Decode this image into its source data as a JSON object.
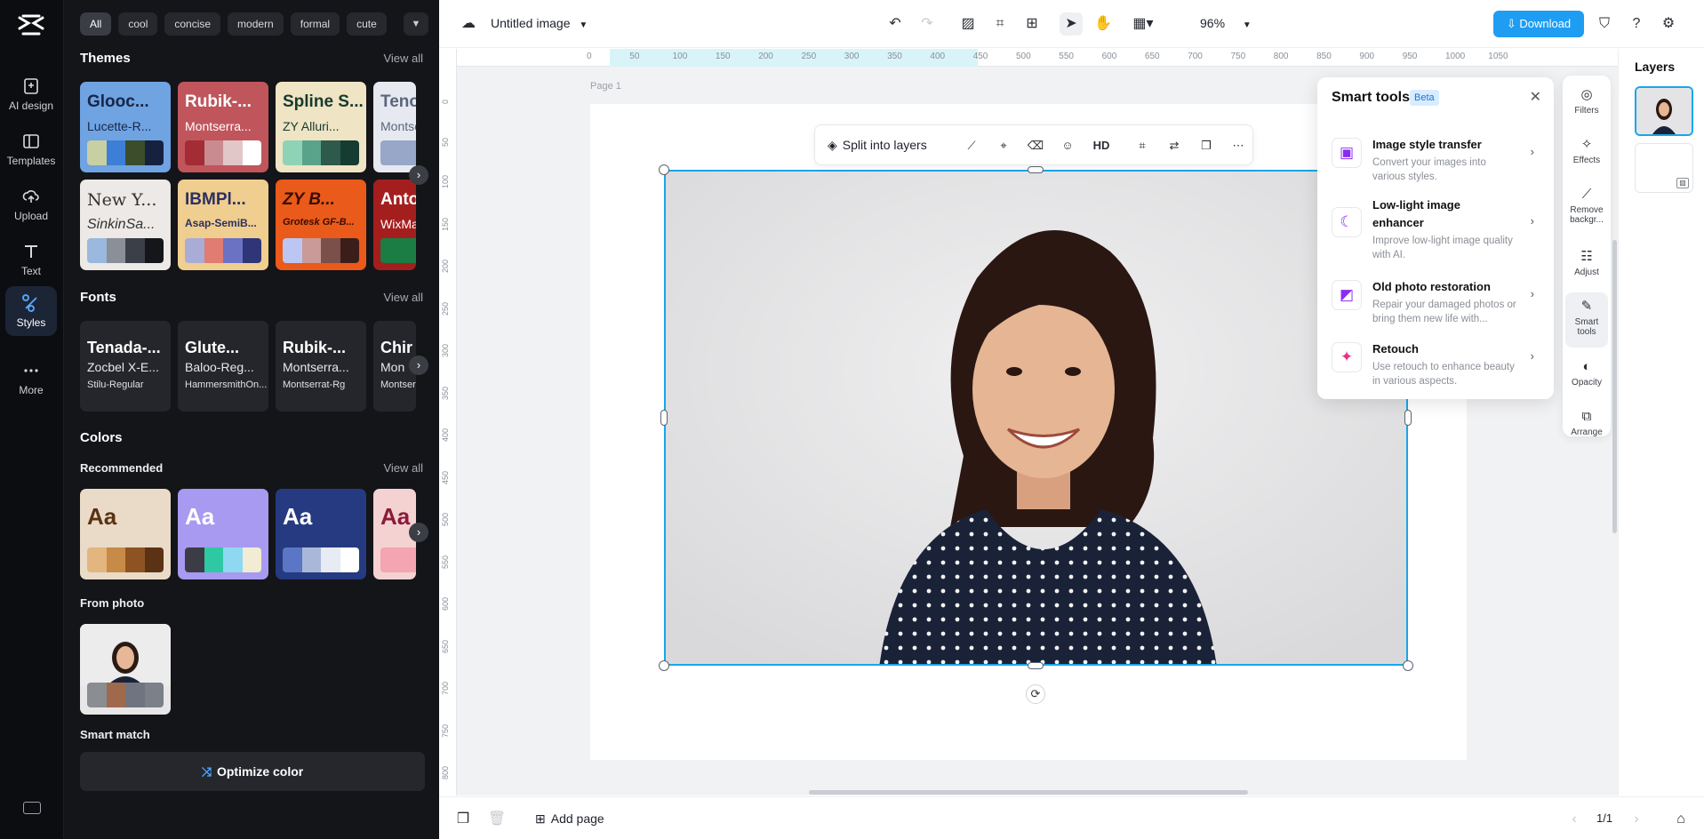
{
  "rail": {
    "items": [
      {
        "label": "AI design",
        "icon": "ai-design-icon"
      },
      {
        "label": "Templates",
        "icon": "templates-icon"
      },
      {
        "label": "Upload",
        "icon": "upload-icon"
      },
      {
        "label": "Text",
        "icon": "text-icon"
      },
      {
        "label": "Styles",
        "icon": "styles-icon",
        "active": true
      },
      {
        "label": "More",
        "icon": "more-dots-icon"
      }
    ]
  },
  "filters": {
    "chips": [
      "All",
      "cool",
      "concise",
      "modern",
      "formal",
      "cute"
    ],
    "selected": "All"
  },
  "themes": {
    "title": "Themes",
    "view_all": "View all",
    "cards": [
      {
        "t1": "Glooc...",
        "t2": "Lucette-R...",
        "bg": "#6fa3e2",
        "fg": "#17264a",
        "swatches": [
          "#c8cfa2",
          "#3d7fd6",
          "#3b4d2b",
          "#16213f"
        ]
      },
      {
        "t1": "Rubik-...",
        "t2": "Montserra...",
        "bg": "#c0555c",
        "fg": "#ffffff",
        "swatches": [
          "#a32c35",
          "#c98b8f",
          "#e1c7c8",
          "#ffffff"
        ]
      },
      {
        "t1": "Spline S...",
        "t2": "ZY Alluri...",
        "bg": "#efe4c4",
        "fg": "#173a2e",
        "swatches": [
          "#8fd3b7",
          "#5aa38b",
          "#2d5a4b",
          "#163b30"
        ]
      },
      {
        "t1": "Tenor",
        "t2": "Montse",
        "bg": "#e6e9f0",
        "fg": "#5b667d",
        "swatches": [
          "#98a6c8",
          "#5f6f99"
        ]
      },
      {
        "t1": "New Y...",
        "t2": "SinkinSa...",
        "bg": "#ece9e6",
        "fg": "#333333",
        "swatches": [
          "#9bb8de",
          "#8a8f98",
          "#3b4048",
          "#14161a"
        ]
      },
      {
        "t1": "IBMPl...",
        "t2": "Asap-SemiB...",
        "bg": "#f0ce8f",
        "fg": "#2b2f62",
        "swatches": [
          "#a8acd6",
          "#e07c72",
          "#6b72c4",
          "#2f3577"
        ]
      },
      {
        "t1": "ZY B...",
        "t2": "Grotesk GF-B...",
        "bg": "#ea5a1a",
        "fg": "#3a0d00",
        "swatches": [
          "#bcc6f3",
          "#c99a97",
          "#7b4f4a",
          "#3b1e1a"
        ]
      },
      {
        "t1": "Antonio",
        "t2": "WixMad",
        "bg": "#a51e1e",
        "fg": "#ffffff",
        "swatches": [
          "#1b7d44",
          "#3fb27a"
        ]
      }
    ]
  },
  "fonts": {
    "title": "Fonts",
    "view_all": "View all",
    "cards": [
      {
        "f1": "Tenada-...",
        "f2": "Zocbel X-E...",
        "f3": "Stilu-Regular"
      },
      {
        "f1": "Glute...",
        "f2": "Baloo-Reg...",
        "f3": "HammersmithOn..."
      },
      {
        "f1": "Rubik-...",
        "f2": "Montserra...",
        "f3": "Montserrat-Rg"
      },
      {
        "f1": "Chir",
        "f2": "Mon",
        "f3": "Montserra"
      }
    ]
  },
  "colors": {
    "title": "Colors",
    "recommended": "Recommended",
    "view_all": "View all",
    "cards": [
      {
        "aa": "Aa",
        "bg": "#eadbc8",
        "fg": "#5a3214",
        "swatches": [
          "#e2b67e",
          "#c88a47",
          "#8e5322",
          "#5a3214"
        ]
      },
      {
        "aa": "Aa",
        "bg": "#a79af0",
        "fg": "#ffffff",
        "swatches": [
          "#3c3c46",
          "#2ec9a4",
          "#8fd8f2",
          "#f2ecd4"
        ]
      },
      {
        "aa": "Aa",
        "bg": "#253a80",
        "fg": "#ffffff",
        "swatches": [
          "#5a76c4",
          "#a9b8d9",
          "#e6ebf4",
          "#ffffff"
        ]
      },
      {
        "aa": "Aa",
        "bg": "#f4d2d2",
        "fg": "#8a1b3a",
        "swatches": [
          "#f5a4b2",
          "#e78a62"
        ]
      }
    ],
    "from_photo": "From photo",
    "photo_swatches": [
      "#8a8d92",
      "#9f6a4c",
      "#6f7480",
      "#7b8089"
    ],
    "smart_match": "Smart match",
    "optimize_label": "Optimize color"
  },
  "topbar": {
    "title": "Untitled image",
    "zoom": "96%",
    "download": "Download"
  },
  "canvas": {
    "page_label": "Page 1",
    "ruler_top": [
      "0",
      "50",
      "100",
      "150",
      "200",
      "250",
      "300",
      "350",
      "400",
      "450",
      "500",
      "550",
      "600",
      "650",
      "700",
      "750",
      "800",
      "850",
      "900",
      "950",
      "1000",
      "1050"
    ],
    "ruler_left": [
      "0",
      "50",
      "100",
      "150",
      "200",
      "250",
      "300",
      "350",
      "400",
      "450",
      "500",
      "550",
      "600",
      "650",
      "700",
      "750",
      "800"
    ]
  },
  "floating_toolbar": {
    "split_label": "Split into layers",
    "hd_label": "HD"
  },
  "smart_tools": {
    "title": "Smart tools",
    "badge": "Beta",
    "items": [
      {
        "name": "Image style transfer",
        "desc": "Convert your images into various styles.",
        "icon": "style-transfer-icon"
      },
      {
        "name": "Low-light image enhancer",
        "desc": "Improve low-light image quality with AI.",
        "icon": "moon-enhance-icon"
      },
      {
        "name": "Old photo restoration",
        "desc": "Repair your damaged photos or bring them new life with...",
        "icon": "photo-restore-icon"
      },
      {
        "name": "Retouch",
        "desc": "Use retouch to enhance beauty in various aspects.",
        "icon": "retouch-icon"
      }
    ]
  },
  "side_tools": [
    {
      "label": "Filters",
      "icon": "filters-icon"
    },
    {
      "label": "Effects",
      "icon": "effects-icon"
    },
    {
      "label": "Remove backgr...",
      "icon": "remove-background-icon"
    },
    {
      "label": "Adjust",
      "icon": "adjust-icon"
    },
    {
      "label": "Smart tools",
      "icon": "smart-tools-icon",
      "active": true
    },
    {
      "label": "Opacity",
      "icon": "opacity-icon"
    },
    {
      "label": "Arrange",
      "icon": "arrange-icon"
    }
  ],
  "bottombar": {
    "add_page": "Add page",
    "page_indicator": "1/1"
  },
  "layers": {
    "title": "Layers"
  },
  "theme_colors": {
    "accent": "#1e9df3",
    "selection": "#1aa5e8",
    "panel_bg": "#141519",
    "rail_bg": "#0c0d10"
  }
}
